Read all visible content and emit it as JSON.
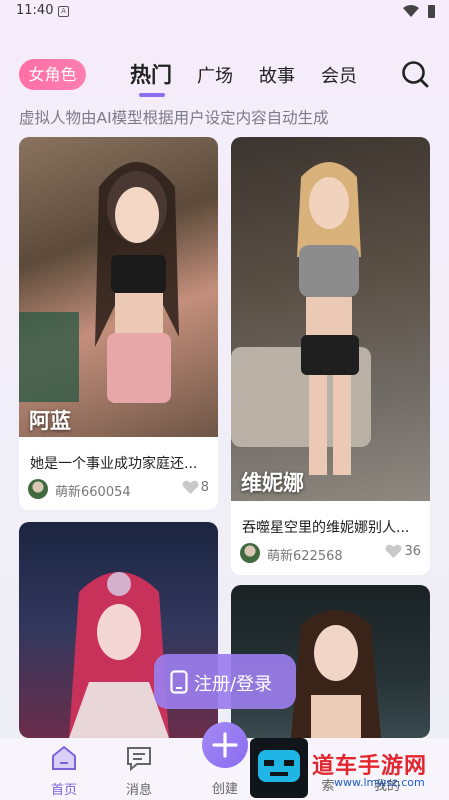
{
  "status": {
    "time": "11:40"
  },
  "header": {
    "category_pill": "女角色",
    "tabs": [
      {
        "label": "热门",
        "active": true
      },
      {
        "label": "广场",
        "active": false
      },
      {
        "label": "故事",
        "active": false
      },
      {
        "label": "会员",
        "active": false
      }
    ],
    "search_icon": "search-icon"
  },
  "subtitle": "虚拟人物由AI模型根据用户设定内容自动生成",
  "cards": [
    {
      "name": "阿蓝",
      "desc": "她是一个事业成功家庭还...",
      "user": "萌新660054",
      "likes": "8"
    },
    {
      "name": "维妮娜",
      "desc": "吞噬星空里的维妮娜别人...",
      "user": "萌新622568",
      "likes": "36"
    }
  ],
  "login_button": "注册/登录",
  "bottom_nav": {
    "home": "首页",
    "messages": "消息",
    "create": "创建",
    "search_partial": "索",
    "mine_partial": "我的"
  },
  "watermark": {
    "text": "道车手游网",
    "url": "www.lmwsz.com"
  },
  "colors": {
    "accent": "#8c6ff0",
    "pill": "#ff6fa5",
    "watermark_red": "#e3262e"
  }
}
